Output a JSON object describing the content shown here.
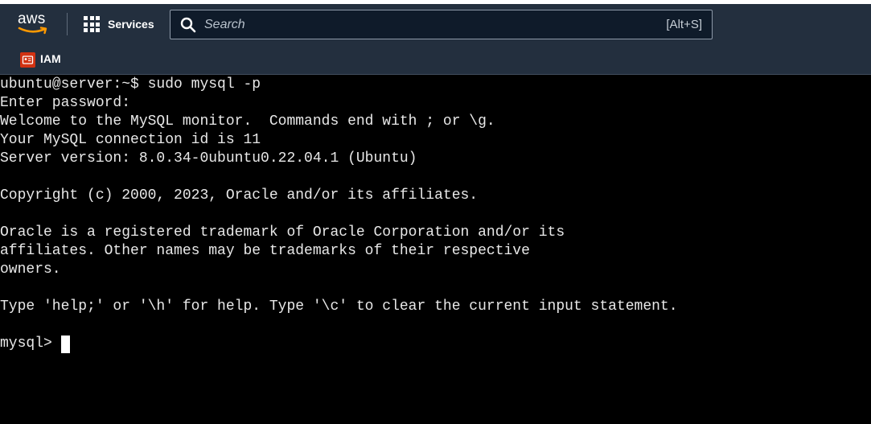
{
  "nav": {
    "logo_text": "aws",
    "services_label": "Services",
    "search_placeholder": "Search",
    "search_shortcut": "[Alt+S]"
  },
  "subnav": {
    "service_label": "IAM"
  },
  "terminal": {
    "lines": [
      "ubuntu@server:~$ sudo mysql -p",
      "Enter password:",
      "Welcome to the MySQL monitor.  Commands end with ; or \\g.",
      "Your MySQL connection id is 11",
      "Server version: 8.0.34-0ubuntu0.22.04.1 (Ubuntu)",
      "",
      "Copyright (c) 2000, 2023, Oracle and/or its affiliates.",
      "",
      "Oracle is a registered trademark of Oracle Corporation and/or its",
      "affiliates. Other names may be trademarks of their respective",
      "owners.",
      "",
      "Type 'help;' or '\\h' for help. Type '\\c' to clear the current input statement.",
      ""
    ],
    "prompt": "mysql>"
  },
  "colors": {
    "nav_bg": "#232f3e",
    "terminal_bg": "#000000",
    "terminal_fg": "#e8e8e8",
    "aws_orange": "#ff9900",
    "iam_red": "#d13212"
  },
  "icons": {
    "logo": "aws-logo-icon",
    "services": "grid-icon",
    "search": "search-icon",
    "iam": "iam-service-icon"
  }
}
